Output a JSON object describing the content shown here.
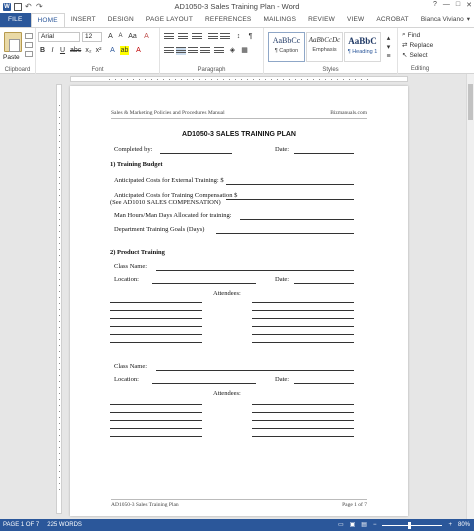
{
  "window": {
    "title": "AD1050-3 Sales Training Plan - Word",
    "controls": [
      "?",
      "—",
      "□",
      "✕"
    ]
  },
  "ribbon_tabs": [
    "FILE",
    "HOME",
    "INSERT",
    "DESIGN",
    "PAGE LAYOUT",
    "REFERENCES",
    "MAILINGS",
    "REVIEW",
    "VIEW",
    "ACROBAT"
  ],
  "user": {
    "name": "Bianca Viviano"
  },
  "ribbon": {
    "clipboard": {
      "paste_label": "Paste",
      "group_label": "Clipboard"
    },
    "font": {
      "name": "Arial",
      "size": "12",
      "group_label": "Font",
      "bold": "B",
      "italic": "I",
      "underline": "U"
    },
    "paragraph": {
      "group_label": "Paragraph"
    },
    "styles": {
      "group_label": "Styles",
      "items": [
        {
          "preview": "AaBbCc",
          "name": "¶ Caption"
        },
        {
          "preview": "AaBbCcDc",
          "name": "Emphasis"
        },
        {
          "preview": "AaBbC",
          "name": "¶ Heading 1"
        }
      ]
    },
    "editing": {
      "group_label": "Editing",
      "find": "Find",
      "replace": "Replace",
      "select": "Select"
    }
  },
  "document": {
    "header_left": "Sales & Marketing Policies and Procedures Manual",
    "header_right": "Bizmanuals.com",
    "title": "AD1050-3 SALES TRAINING PLAN",
    "completed_by": "Completed by:",
    "date": "Date:",
    "section1": "1)  Training Budget",
    "ext_training": "Anticipated Costs for External Training: $",
    "comp_training": "Anticipated Costs for Training Compensation $",
    "see_ref": "(See AD1010 SALES COMPENSATION)",
    "man_hours": "Man Hours/Man Days Allocated for training:",
    "dept_goals": "Department Training Goals (Days)",
    "section2": "2)  Product Training",
    "class_name": "Class Name:",
    "location": "Location:",
    "attendees": "Attendees:",
    "footer_left": "AD1050-3 Sales Training Plan",
    "footer_right": "Page 1 of 7"
  },
  "status": {
    "page": "PAGE 1 OF 7",
    "words": "225 WORDS",
    "zoom": "80%"
  }
}
